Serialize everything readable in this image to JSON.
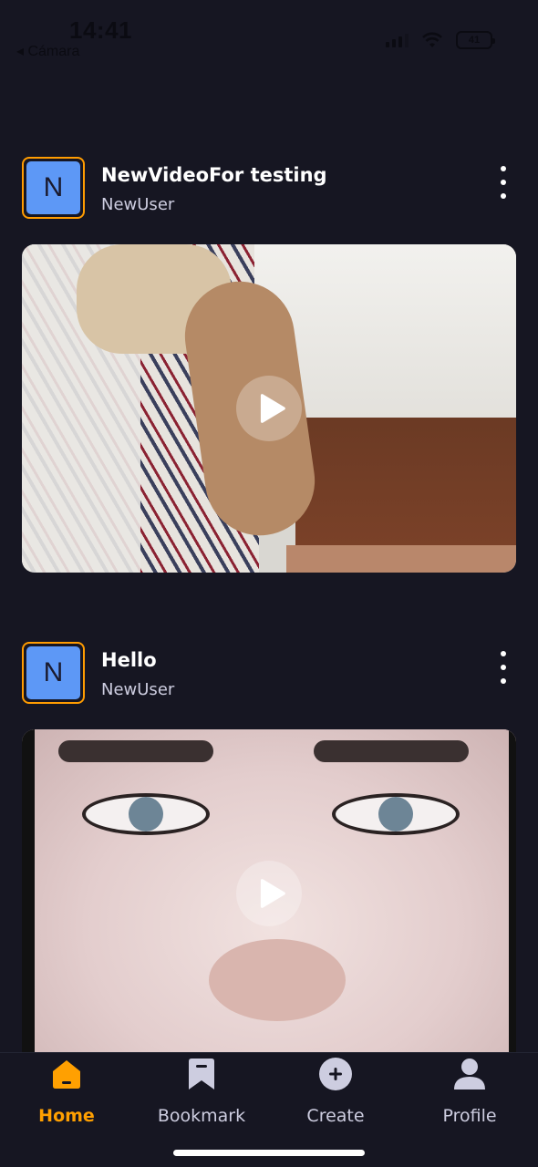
{
  "status_bar": {
    "time": "14:41",
    "back_label": "◂ Cámara",
    "battery": "41"
  },
  "posts": [
    {
      "title": "NewVideoFor testing",
      "creator": "NewUser",
      "avatar_initial": "N",
      "thumbnail": "dog-on-bed-video"
    },
    {
      "title": "Hello",
      "creator": "NewUser",
      "avatar_initial": "N",
      "thumbnail": "face-closeup-video"
    }
  ],
  "tabs": [
    {
      "label": "Home",
      "icon": "home-icon",
      "active": true
    },
    {
      "label": "Bookmark",
      "icon": "bookmark-icon",
      "active": false
    },
    {
      "label": "Create",
      "icon": "plus-circle-icon",
      "active": false
    },
    {
      "label": "Profile",
      "icon": "profile-icon",
      "active": false
    }
  ],
  "colors": {
    "background": "#161622",
    "accent": "#ffa001",
    "avatar_bg": "#5d98f6",
    "muted_text": "#cdcde0"
  }
}
